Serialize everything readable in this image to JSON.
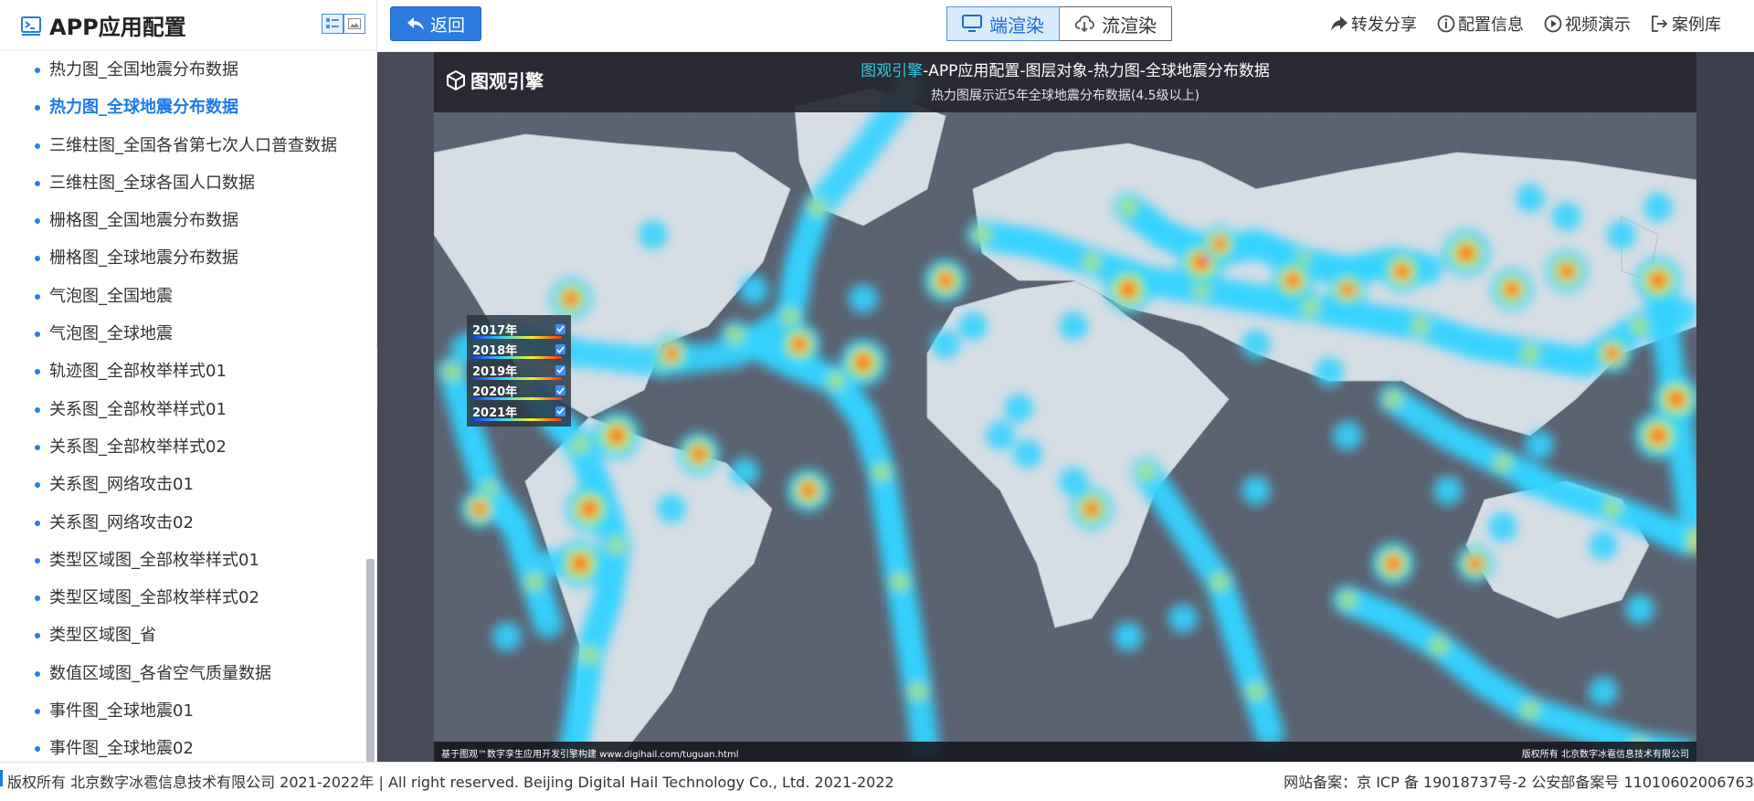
{
  "sidebar": {
    "title": "APP应用配置",
    "items": [
      {
        "label": "热力图_全国地震分布数据",
        "active": false
      },
      {
        "label": "热力图_全球地震分布数据",
        "active": true
      },
      {
        "label": "三维柱图_全国各省第七次人口普查数据",
        "active": false
      },
      {
        "label": "三维柱图_全球各国人口数据",
        "active": false
      },
      {
        "label": "栅格图_全国地震分布数据",
        "active": false
      },
      {
        "label": "栅格图_全球地震分布数据",
        "active": false
      },
      {
        "label": "气泡图_全国地震",
        "active": false
      },
      {
        "label": "气泡图_全球地震",
        "active": false
      },
      {
        "label": "轨迹图_全部枚举样式01",
        "active": false
      },
      {
        "label": "关系图_全部枚举样式01",
        "active": false
      },
      {
        "label": "关系图_全部枚举样式02",
        "active": false
      },
      {
        "label": "关系图_网络攻击01",
        "active": false
      },
      {
        "label": "关系图_网络攻击02",
        "active": false
      },
      {
        "label": "类型区域图_全部枚举样式01",
        "active": false
      },
      {
        "label": "类型区域图_全部枚举样式02",
        "active": false
      },
      {
        "label": "类型区域图_省",
        "active": false
      },
      {
        "label": "数值区域图_各省空气质量数据",
        "active": false
      },
      {
        "label": "事件图_全球地震01",
        "active": false
      },
      {
        "label": "事件图_全球地震02",
        "active": false
      }
    ]
  },
  "toolbar": {
    "back_label": "返回",
    "render_tabs": [
      {
        "label": "端渲染",
        "active": true
      },
      {
        "label": "流渲染",
        "active": false
      }
    ],
    "links": [
      {
        "label": "转发分享",
        "icon": "share-icon"
      },
      {
        "label": "配置信息",
        "icon": "info-icon"
      },
      {
        "label": "视频演示",
        "icon": "play-icon"
      },
      {
        "label": "案例库",
        "icon": "exit-icon"
      }
    ]
  },
  "viewer": {
    "logo_text": "图观引擎",
    "title_highlight": "图观引擎",
    "title_rest": "-APP应用配置-图层对象-热力图-全球地震分布数据",
    "subtitle": "热力图展示近5年全球地震分布数据(4.5级以上)",
    "legend": [
      {
        "label": "2017年",
        "checked": true
      },
      {
        "label": "2018年",
        "checked": true
      },
      {
        "label": "2019年",
        "checked": true
      },
      {
        "label": "2020年",
        "checked": true
      },
      {
        "label": "2021年",
        "checked": true
      }
    ],
    "footer_left": "基于图观™数字孪生应用开发引擎构建 www.digihail.com/tuguan.html",
    "footer_right": "版权所有 北京数字冰雹信息技术有限公司"
  },
  "colors": {
    "accent": "#2c7be0",
    "heat_low": "#33d3ff",
    "heat_mid": "#f2f21a",
    "heat_high": "#ff2a1a"
  },
  "footer": {
    "copyright": "版权所有 北京数字冰雹信息技术有限公司 2021-2022年 | All right reserved. Beijing Digital Hail Technology Co., Ltd. 2021-2022",
    "icp": "网站备案：京 ICP 备 19018737号-2 公安部备案号 11010602006763"
  }
}
